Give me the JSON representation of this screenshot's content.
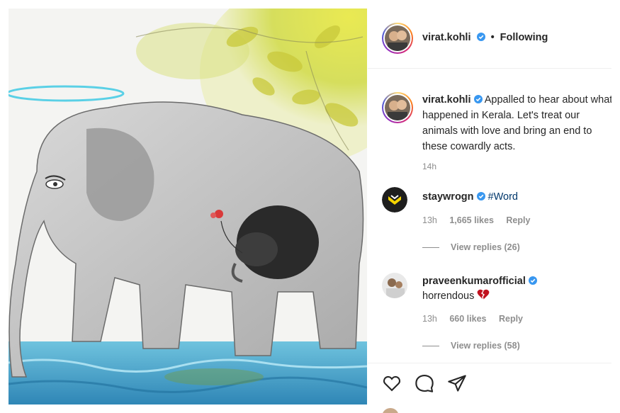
{
  "post": {
    "author": "virat.kohli",
    "follow_status": "Following",
    "separator": "•",
    "caption": "Appalled to hear about what happened in Kerala. Let's treat our animals with love and bring an end to these cowardly acts.",
    "time": "14h"
  },
  "comments": [
    {
      "username": "staywrogn",
      "hashtag": "#Word",
      "text": "",
      "time": "13h",
      "likes": "1,665 likes",
      "reply": "Reply",
      "view_replies": "View replies (26)"
    },
    {
      "username": "praveenkumarofficial",
      "hashtag": "",
      "text": "horrendous",
      "time": "13h",
      "likes": "660 likes",
      "reply": "Reply",
      "view_replies": "View replies (58)"
    }
  ],
  "icons": {
    "verified": "verified-badge-icon",
    "like": "heart-icon",
    "comment": "comment-bubble-icon",
    "share": "paper-plane-icon",
    "emoji": "broken-heart-emoji"
  },
  "colors": {
    "verified": "#3897f0",
    "link": "#00376b",
    "muted": "#8e8e8e",
    "text": "#262626",
    "emoji_red": "#c1121f"
  }
}
